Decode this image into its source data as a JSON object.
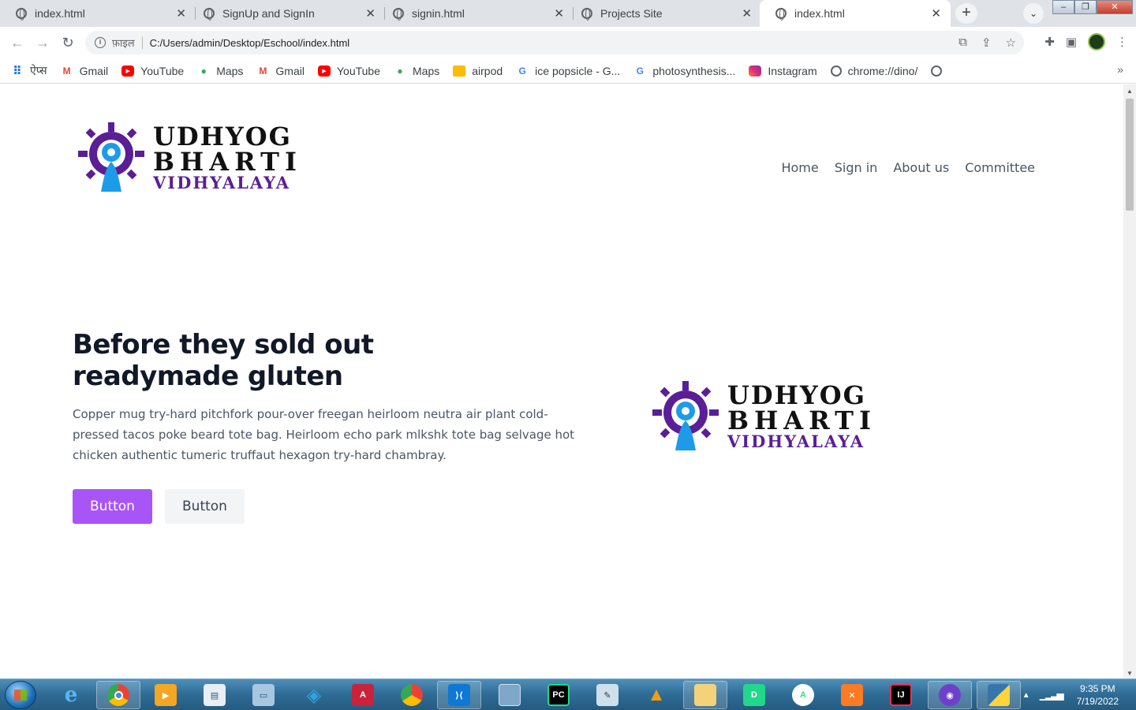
{
  "browser": {
    "tabs": [
      {
        "title": "index.html",
        "active": false
      },
      {
        "title": "SignUp and SignIn",
        "active": false
      },
      {
        "title": "signin.html",
        "active": false
      },
      {
        "title": "Projects Site",
        "active": false
      },
      {
        "title": "index.html",
        "active": true
      }
    ],
    "address": {
      "scheme_label": "फ़ाइल",
      "url": "C:/Users/admin/Desktop/Eschool/index.html"
    },
    "bookmarks": [
      {
        "label": "ऐप्स",
        "icon": "apps-grid-icon"
      },
      {
        "label": "Gmail",
        "icon": "gmail-icon"
      },
      {
        "label": "YouTube",
        "icon": "youtube-icon"
      },
      {
        "label": "Maps",
        "icon": "maps-pin-icon"
      },
      {
        "label": "Gmail",
        "icon": "gmail-icon"
      },
      {
        "label": "YouTube",
        "icon": "youtube-icon"
      },
      {
        "label": "Maps",
        "icon": "maps-pin-icon"
      },
      {
        "label": "airpod",
        "icon": "flipkart-icon"
      },
      {
        "label": "ice popsicle - G...",
        "icon": "google-icon"
      },
      {
        "label": "photosynthesis...",
        "icon": "google-icon"
      },
      {
        "label": "Instagram",
        "icon": "instagram-icon"
      },
      {
        "label": "chrome://dino/",
        "icon": "globe-icon"
      },
      {
        "label": "",
        "icon": "globe-icon"
      }
    ]
  },
  "site": {
    "logo": {
      "line1": "UDHYOG",
      "line2": "BHARTI",
      "line3": "VIDHYALAYA"
    },
    "nav": [
      "Home",
      "Sign in",
      "About us",
      "Committee"
    ],
    "hero": {
      "title": "Before they sold out readymade gluten",
      "text": "Copper mug try-hard pitchfork pour-over freegan heirloom neutra air plant cold-pressed tacos poke beard tote bag. Heirloom echo park mlkshk tote bag selvage hot chicken authentic tumeric truffaut hexagon try-hard chambray.",
      "primary_button": "Button",
      "secondary_button": "Button"
    }
  },
  "taskbar": {
    "apps": [
      "internet-explorer-icon",
      "chrome-icon",
      "media-player-icon",
      "notepad-icon",
      "remote-desktop-icon",
      "sourcetree-icon",
      "acrobat-icon",
      "chrome-canary-icon",
      "vscode-icon",
      "blank-app-icon",
      "pycharm-icon",
      "writer-icon",
      "vlc-icon",
      "file-explorer-icon",
      "dataspell-icon",
      "android-studio-icon",
      "xampp-icon",
      "intellij-icon",
      "github-desktop-icon",
      "python-icon"
    ],
    "time": "9:35 PM",
    "date": "7/19/2022"
  },
  "colors": {
    "primary_button": "#a855f7",
    "logo_purple": "#5a1e96",
    "logo_blue": "#1e9be8"
  }
}
